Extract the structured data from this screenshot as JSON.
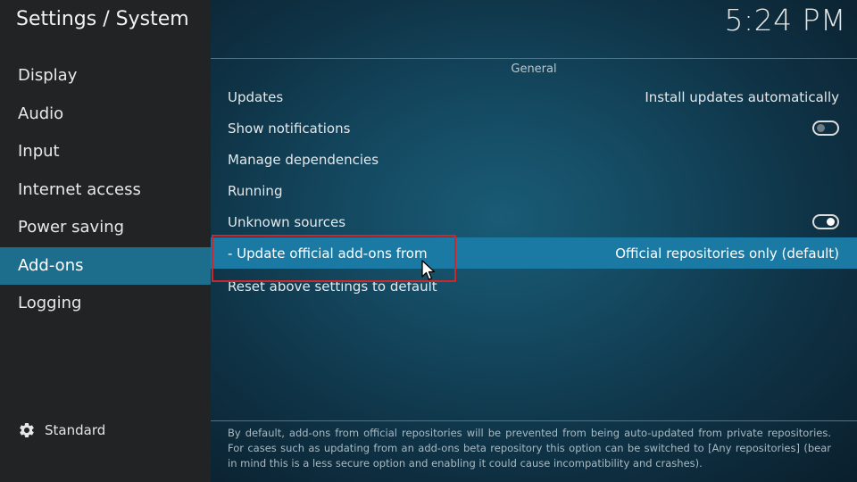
{
  "window": {
    "title": "Settings / System",
    "clock": "5:24 PM"
  },
  "sidebar": {
    "items": [
      {
        "label": "Display"
      },
      {
        "label": "Audio"
      },
      {
        "label": "Input"
      },
      {
        "label": "Internet access"
      },
      {
        "label": "Power saving"
      },
      {
        "label": "Add-ons",
        "active": true
      },
      {
        "label": "Logging"
      }
    ],
    "level": {
      "icon": "gear-icon",
      "label": "Standard"
    }
  },
  "main": {
    "section_title": "General",
    "settings": [
      {
        "label": "Updates",
        "value": "Install updates automatically"
      },
      {
        "label": "Show notifications",
        "toggle": "off"
      },
      {
        "label": "Manage dependencies"
      },
      {
        "label": "Running"
      },
      {
        "label": "Unknown sources",
        "toggle": "on"
      },
      {
        "label": "- Update official add-ons from",
        "value": "Official repositories only (default)",
        "focused": true
      },
      {
        "label": "Reset above settings to default"
      }
    ],
    "description": "By default, add-ons from official repositories will be prevented from being auto-updated from private repositories. For cases such as updating from an add-ons beta repository this option can be switched to [Any repositories] (bear in mind this is a less secure option and enabling it could cause incompatibility and crashes)."
  },
  "colors": {
    "sidebar_bg": "#212325",
    "active_item": "#1d6e8d",
    "focused_row": "#1a7aa4",
    "annotation_box": "#c9282d"
  }
}
